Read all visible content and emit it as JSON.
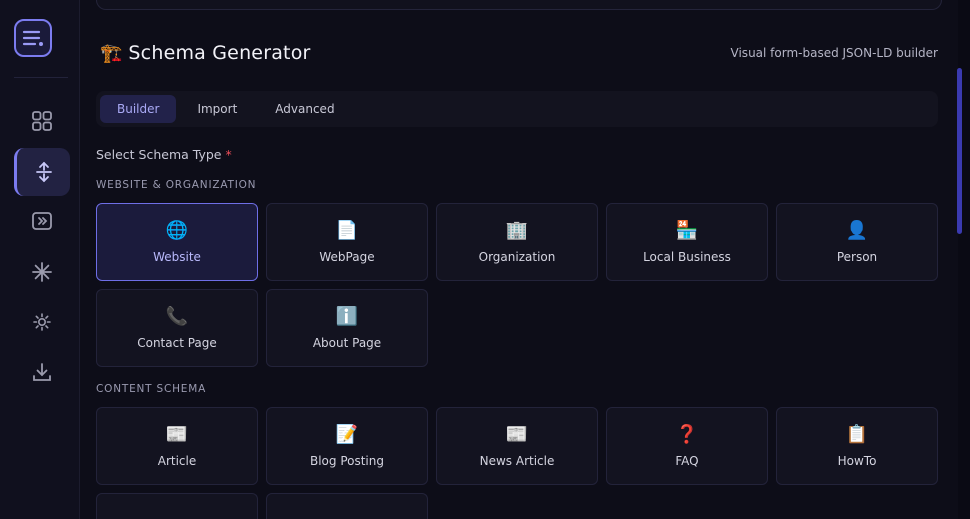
{
  "sidebar": {
    "logo_icon": "list-menu-icon",
    "items": [
      {
        "name": "dashboard",
        "icon": "grid-icon",
        "active": false
      },
      {
        "name": "schema",
        "icon": "up-down-arrows-icon",
        "active": true
      },
      {
        "name": "redirect",
        "icon": "forward-box-icon",
        "active": false
      },
      {
        "name": "sparkle",
        "icon": "asterisk-icon",
        "active": false
      },
      {
        "name": "settings",
        "icon": "sun-gear-icon",
        "active": false
      },
      {
        "name": "export",
        "icon": "download-icon",
        "active": false
      }
    ]
  },
  "header": {
    "icon": "🏗️",
    "title": "Schema Generator",
    "subtitle": "Visual form-based JSON-LD builder"
  },
  "tabs": [
    {
      "label": "Builder",
      "active": true
    },
    {
      "label": "Import",
      "active": false
    },
    {
      "label": "Advanced",
      "active": false
    }
  ],
  "form": {
    "label": "Select Schema Type",
    "required_mark": "*"
  },
  "sections": [
    {
      "title": "WEBSITE & ORGANIZATION",
      "items": [
        {
          "label": "Website",
          "icon": "🌐",
          "selected": true
        },
        {
          "label": "WebPage",
          "icon": "📄",
          "selected": false
        },
        {
          "label": "Organization",
          "icon": "🏢",
          "selected": false
        },
        {
          "label": "Local Business",
          "icon": "🏪",
          "selected": false
        },
        {
          "label": "Person",
          "icon": "👤",
          "selected": false
        },
        {
          "label": "Contact Page",
          "icon": "📞",
          "selected": false
        },
        {
          "label": "About Page",
          "icon": "ℹ️",
          "selected": false
        }
      ]
    },
    {
      "title": "CONTENT SCHEMA",
      "items": [
        {
          "label": "Article",
          "icon": "📰",
          "selected": false
        },
        {
          "label": "Blog Posting",
          "icon": "📝",
          "selected": false
        },
        {
          "label": "News Article",
          "icon": "📰",
          "selected": false
        },
        {
          "label": "FAQ",
          "icon": "❓",
          "selected": false
        },
        {
          "label": "HowTo",
          "icon": "📋",
          "selected": false
        }
      ]
    }
  ],
  "colors": {
    "accent": "#7c7cf0",
    "background": "#0b0b16",
    "card": "#131320",
    "required": "#ef4f5a"
  }
}
